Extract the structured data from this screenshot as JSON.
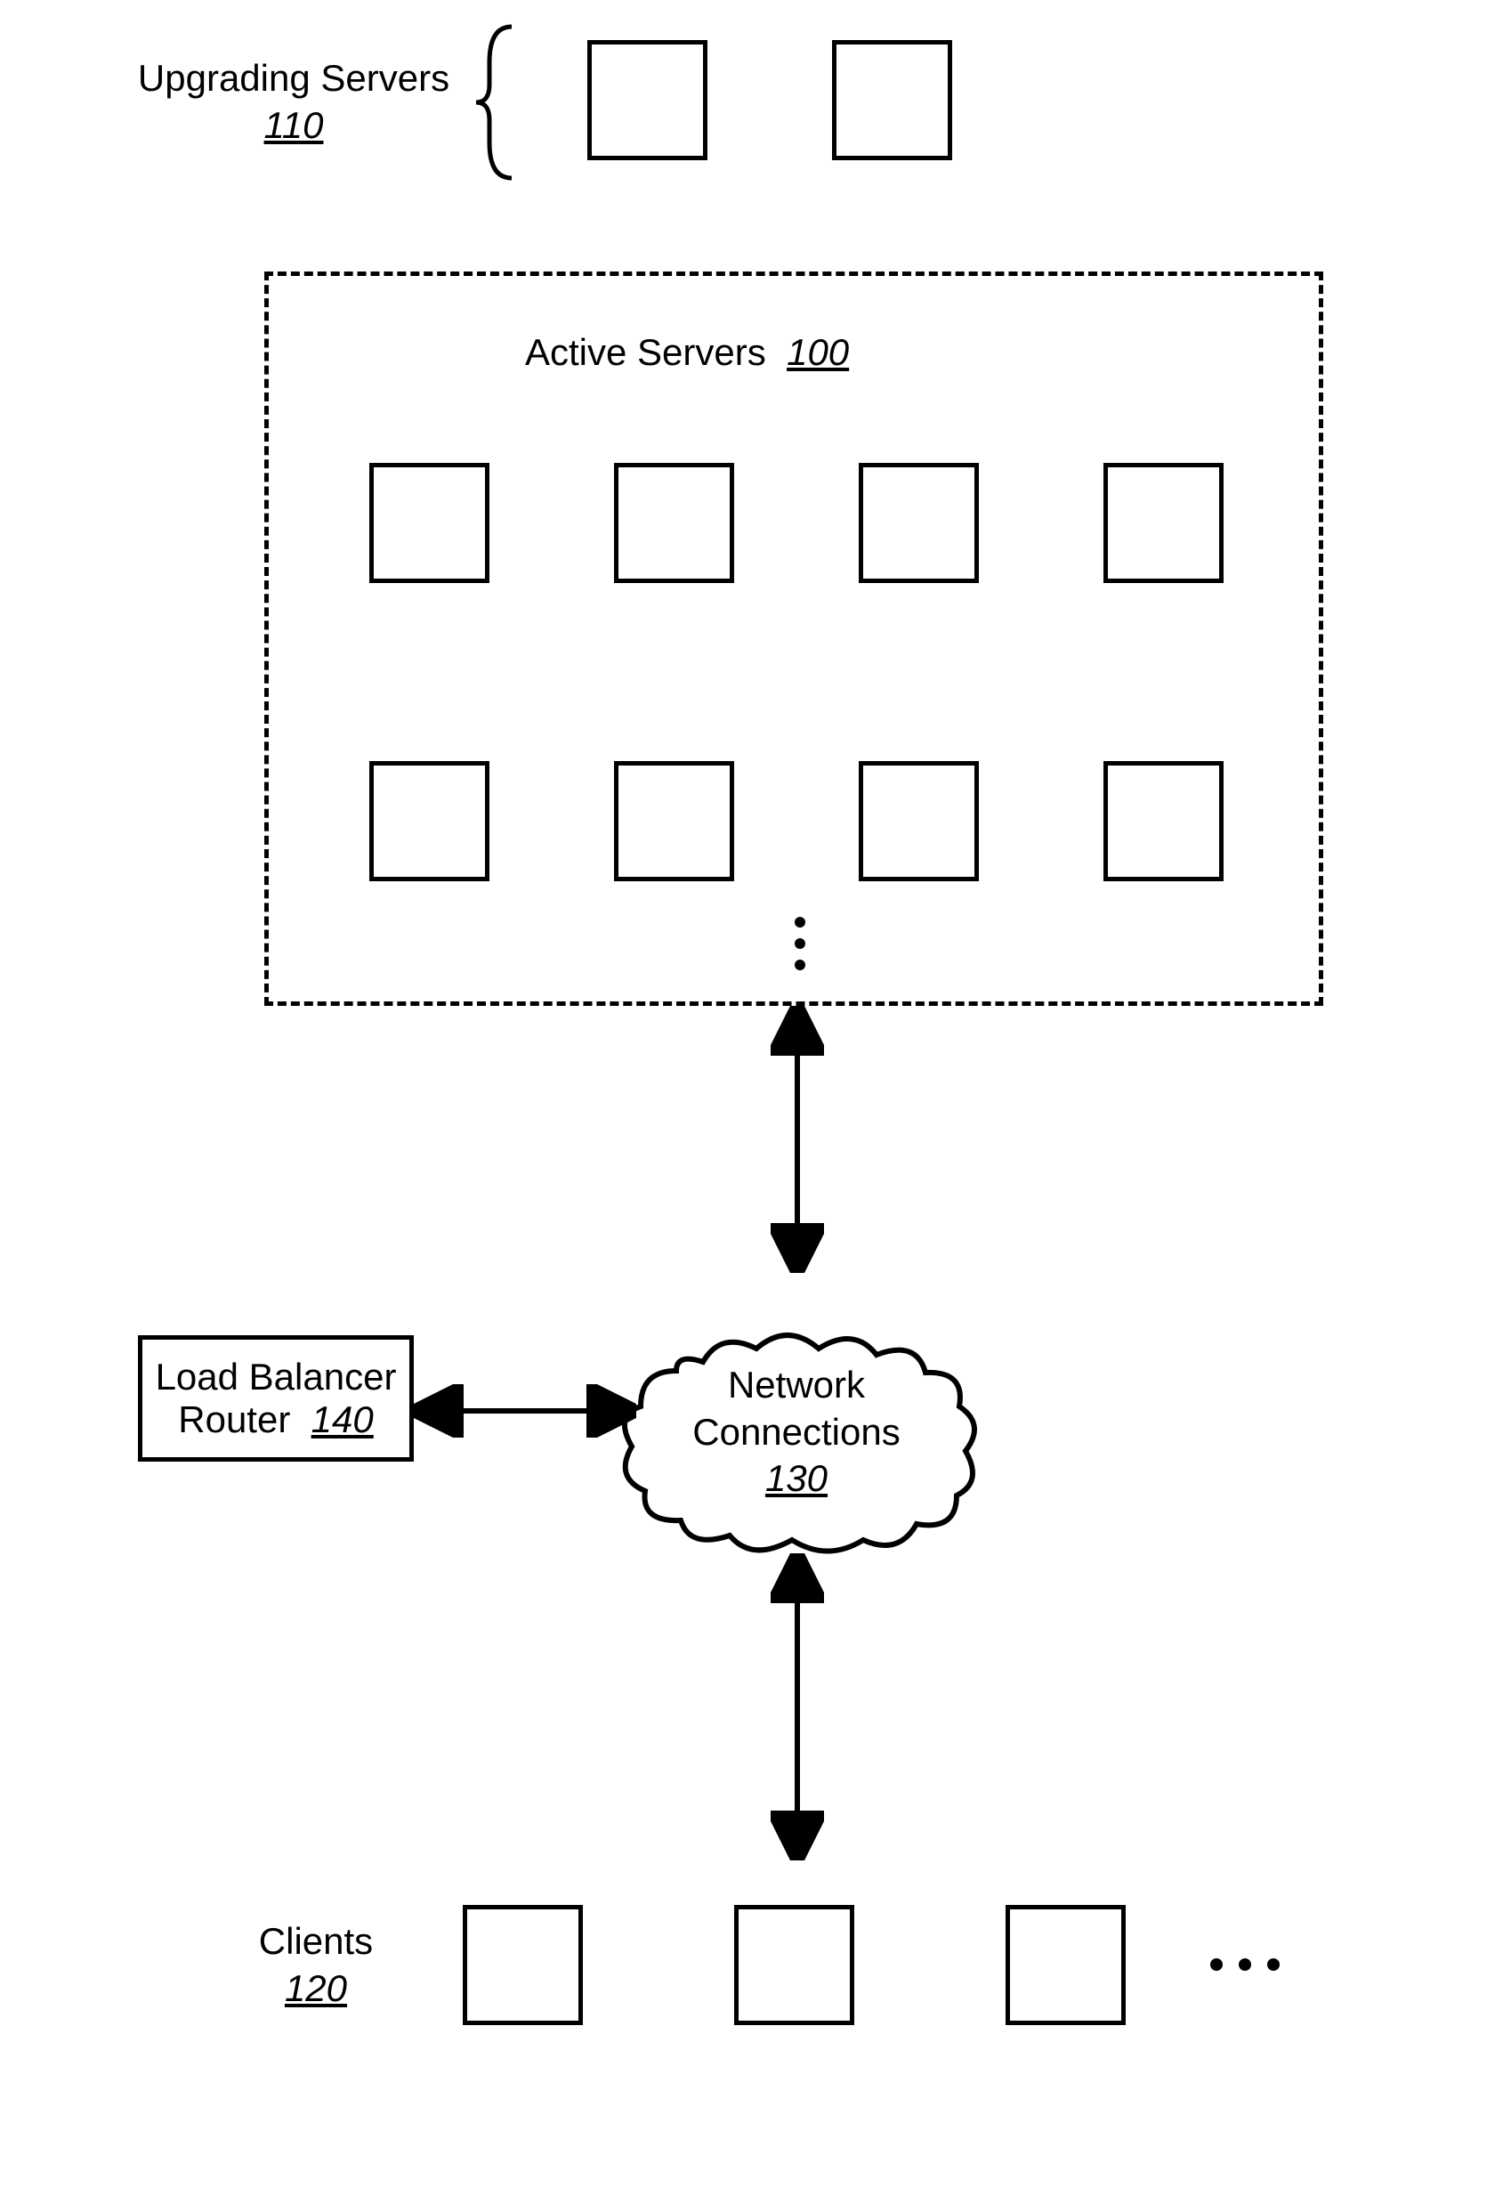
{
  "upgrading": {
    "label": "Upgrading Servers",
    "ref": "110"
  },
  "active": {
    "label": "Active Servers",
    "ref": "100"
  },
  "network": {
    "label_line1": "Network",
    "label_line2": "Connections",
    "ref": "130"
  },
  "loadbalancer": {
    "line1": "Load Balancer",
    "line2_prefix": "Router",
    "ref": "140"
  },
  "clients": {
    "label": "Clients",
    "ref": "120"
  }
}
